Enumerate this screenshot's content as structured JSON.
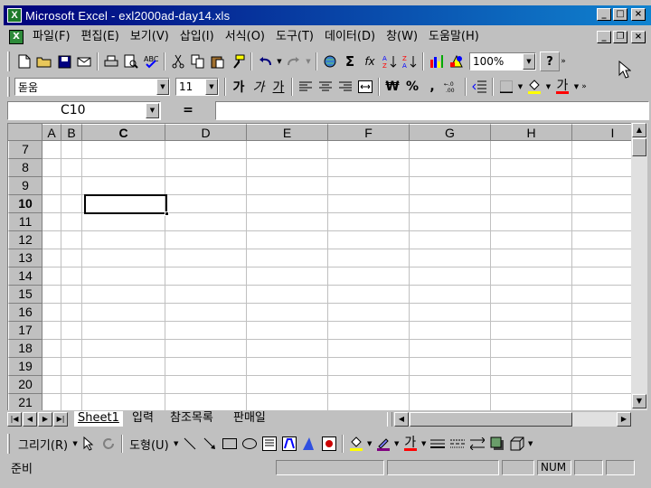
{
  "window": {
    "title": "Microsoft Excel - exl2000ad-day14.xls",
    "minimize": "_",
    "maximize": "□",
    "close": "×",
    "doc_minimize": "_",
    "doc_restore": "❐",
    "doc_close": "×"
  },
  "menu": {
    "items": [
      {
        "label": "파일(F)"
      },
      {
        "label": "편집(E)"
      },
      {
        "label": "보기(V)"
      },
      {
        "label": "삽입(I)"
      },
      {
        "label": "서식(O)"
      },
      {
        "label": "도구(T)"
      },
      {
        "label": "데이터(D)"
      },
      {
        "label": "창(W)"
      },
      {
        "label": "도움말(H)"
      }
    ]
  },
  "standard_toolbar": {
    "sum_symbol": "Σ",
    "fx_symbol": "fx",
    "zoom": "100%",
    "help": "?"
  },
  "format_toolbar": {
    "font": "돋움",
    "size": "11",
    "bold": "가",
    "italic": "가",
    "underline": "가",
    "currency": "₩",
    "percent": "%",
    "comma": ",",
    "font_color_glyph": "가"
  },
  "formula_bar": {
    "name_box": "C10",
    "equals": "=",
    "value": ""
  },
  "grid": {
    "columns": [
      "A",
      "B",
      "C",
      "D",
      "E",
      "F",
      "G",
      "H",
      "I"
    ],
    "rows": [
      "7",
      "8",
      "9",
      "10",
      "11",
      "12",
      "13",
      "14",
      "15",
      "16",
      "17",
      "18",
      "19",
      "20",
      "21"
    ],
    "active_column": "C",
    "active_row": "10"
  },
  "sheet_tabs": [
    {
      "label": "Sheet1",
      "active": true
    },
    {
      "label": "입력",
      "active": false
    },
    {
      "label": "참조목록",
      "active": false
    },
    {
      "label": "판매일",
      "active": false
    }
  ],
  "drawing_toolbar": {
    "draw_menu": "그리기(R)",
    "autoshapes_menu": "도형(U)",
    "font_color_glyph": "가"
  },
  "status_bar": {
    "text": "준비",
    "num": "NUM"
  },
  "colors": {
    "title_start": "#00007b",
    "title_end": "#1084d0",
    "chrome": "#c0c0c0"
  }
}
